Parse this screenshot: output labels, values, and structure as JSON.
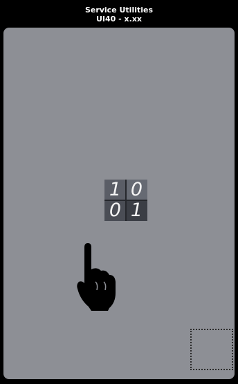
{
  "header": {
    "title": "Service Utilities",
    "subtitle": "UI40 - x.xx"
  },
  "binary_icon": {
    "digits": [
      [
        "1",
        "0"
      ],
      [
        "0",
        "1"
      ]
    ]
  },
  "icons": {
    "binary": "binary-digits-icon",
    "pointer": "pointing-hand-icon",
    "selection": "selection-box"
  },
  "colors": {
    "background": "#000000",
    "panel": "#8d8f95",
    "header_text": "#ffffff"
  }
}
